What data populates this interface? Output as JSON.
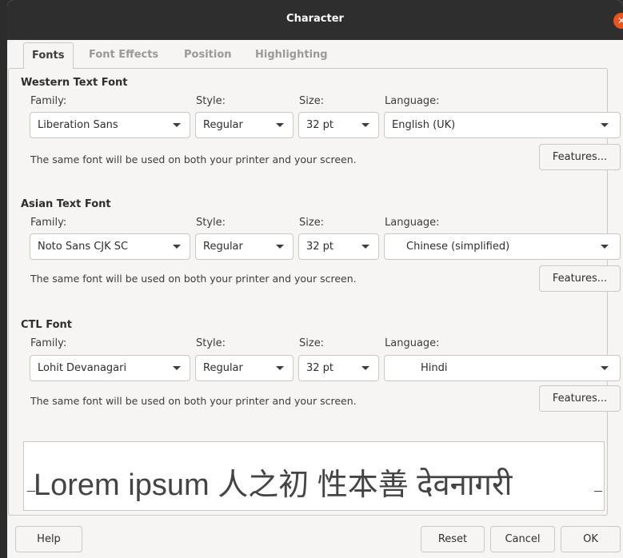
{
  "window": {
    "title": "Character"
  },
  "tabs": [
    {
      "label": "Fonts"
    },
    {
      "label": "Font Effects"
    },
    {
      "label": "Position"
    },
    {
      "label": "Highlighting"
    }
  ],
  "labels": {
    "family": "Family:",
    "style": "Style:",
    "size": "Size:",
    "language": "Language:"
  },
  "western": {
    "title": "Western Text Font",
    "family": "Liberation Sans",
    "style": "Regular",
    "size": "32 pt",
    "language": "English (UK)",
    "note": "The same font will be used on both your printer and your screen.",
    "features": "Features..."
  },
  "asian": {
    "title": "Asian Text Font",
    "family": "Noto Sans CJK SC",
    "style": "Regular",
    "size": "32 pt",
    "language": "Chinese (simplified)",
    "note": "The same font will be used on both your printer and your screen.",
    "features": "Features..."
  },
  "ctl": {
    "title": "CTL Font",
    "family": "Lohit Devanagari",
    "style": "Regular",
    "size": "32 pt",
    "language": "Hindi",
    "note": "The same font will be used on both your printer and your screen.",
    "features": "Features..."
  },
  "preview": {
    "text": "Lorem ipsum   人之初 性本善  देवनागरी"
  },
  "buttons": {
    "help": "Help",
    "reset": "Reset",
    "cancel": "Cancel",
    "ok": "OK"
  },
  "icons": {
    "close": "close-icon",
    "dropdown": "chevron-down-icon"
  },
  "colors": {
    "titlebar": "#2e2e2e",
    "close": "#e95420",
    "background": "#f6f5f4"
  }
}
